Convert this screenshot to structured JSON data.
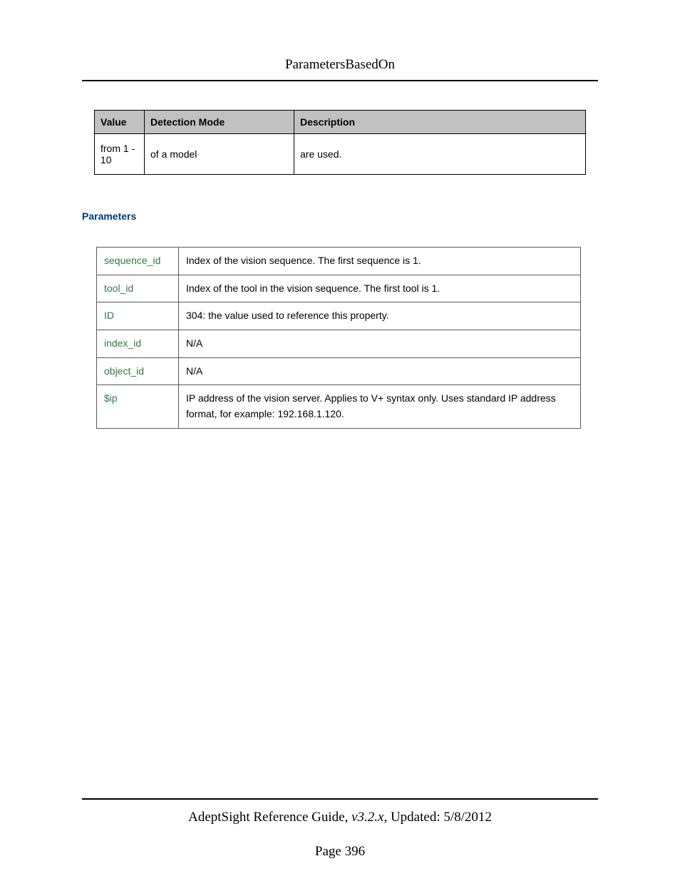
{
  "header": {
    "title": "ParametersBasedOn"
  },
  "detect_table": {
    "headers": [
      "Value",
      "Detection Mode",
      "Description"
    ],
    "row": {
      "value": "from 1 - 10",
      "mode": "of a model",
      "desc": "are used."
    }
  },
  "section": {
    "title": "Parameters"
  },
  "params": [
    {
      "name": "sequence_id",
      "desc": "Index of the vision sequence. The first sequence is 1."
    },
    {
      "name": "tool_id",
      "desc": "Index of the tool in the vision sequence. The first tool is 1."
    },
    {
      "name": "ID",
      "desc": "304: the value used to reference this property."
    },
    {
      "name": "index_id",
      "desc": "N/A"
    },
    {
      "name": "object_id",
      "desc": "N/A"
    },
    {
      "name": "$ip",
      "desc": "IP address of the vision server. Applies to V+ syntax only. Uses standard IP address format, for example: 192.168.1.120."
    }
  ],
  "footer": {
    "guide": "AdeptSight Reference Guide",
    "sep": ", ",
    "version": "v3.2.x",
    "updated": ", Updated: 5/8/2012",
    "page": "Page 396"
  }
}
